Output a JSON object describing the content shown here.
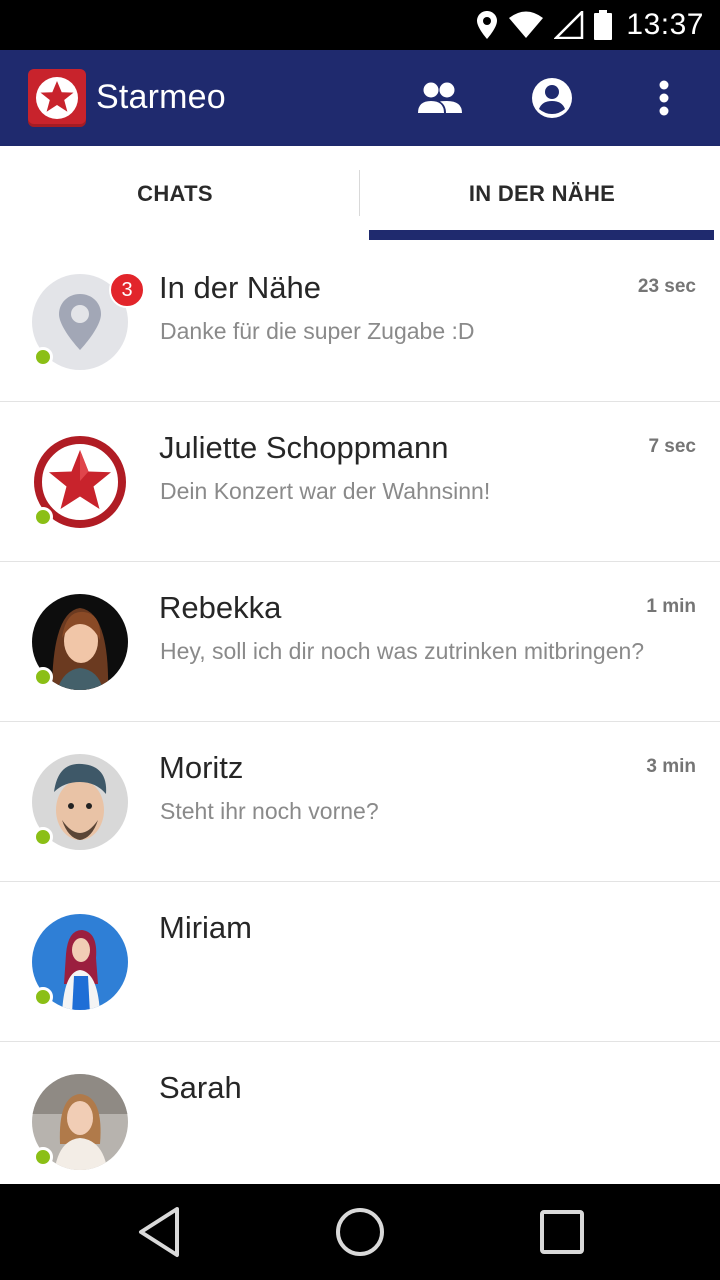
{
  "status_bar": {
    "time": "13:37",
    "icons": [
      "location-icon",
      "wifi-icon",
      "signal-icon",
      "battery-icon"
    ]
  },
  "app_bar": {
    "title": "Starmeo",
    "actions": [
      "people-icon",
      "account-icon",
      "more-vert-icon"
    ],
    "colors": {
      "primary": "#1f2a6e",
      "brand_red": "#c8232c"
    }
  },
  "tabs": [
    {
      "label": "CHATS",
      "selected": false
    },
    {
      "label": "IN DER NÄHE",
      "selected": true
    }
  ],
  "chats": [
    {
      "name": "In der Nähe",
      "message": "Danke für die super Zugabe :D",
      "time": "23 sec",
      "badge": "3",
      "online": true,
      "avatar": "location-pin-avatar"
    },
    {
      "name": "Juliette Schoppmann",
      "message": "Dein Konzert war der Wahnsinn!",
      "time": "7 sec",
      "online": true,
      "avatar": "star-logo-avatar"
    },
    {
      "name": "Rebekka",
      "message": "Hey, soll ich dir noch was zutrinken mitbringen?",
      "time": "1 min",
      "online": true,
      "avatar": "photo-avatar"
    },
    {
      "name": "Moritz",
      "message": "Steht ihr noch vorne?",
      "time": "3 min",
      "online": true,
      "avatar": "photo-avatar"
    },
    {
      "name": "Miriam",
      "message": "",
      "time": "",
      "online": true,
      "avatar": "photo-avatar"
    },
    {
      "name": "Sarah",
      "message": "",
      "time": "",
      "online": true,
      "avatar": "photo-avatar"
    }
  ],
  "nav_bar": {
    "buttons": [
      "back-icon",
      "home-icon",
      "recents-icon"
    ]
  },
  "online_color": "#8bbf16",
  "badge_color": "#e2252b"
}
